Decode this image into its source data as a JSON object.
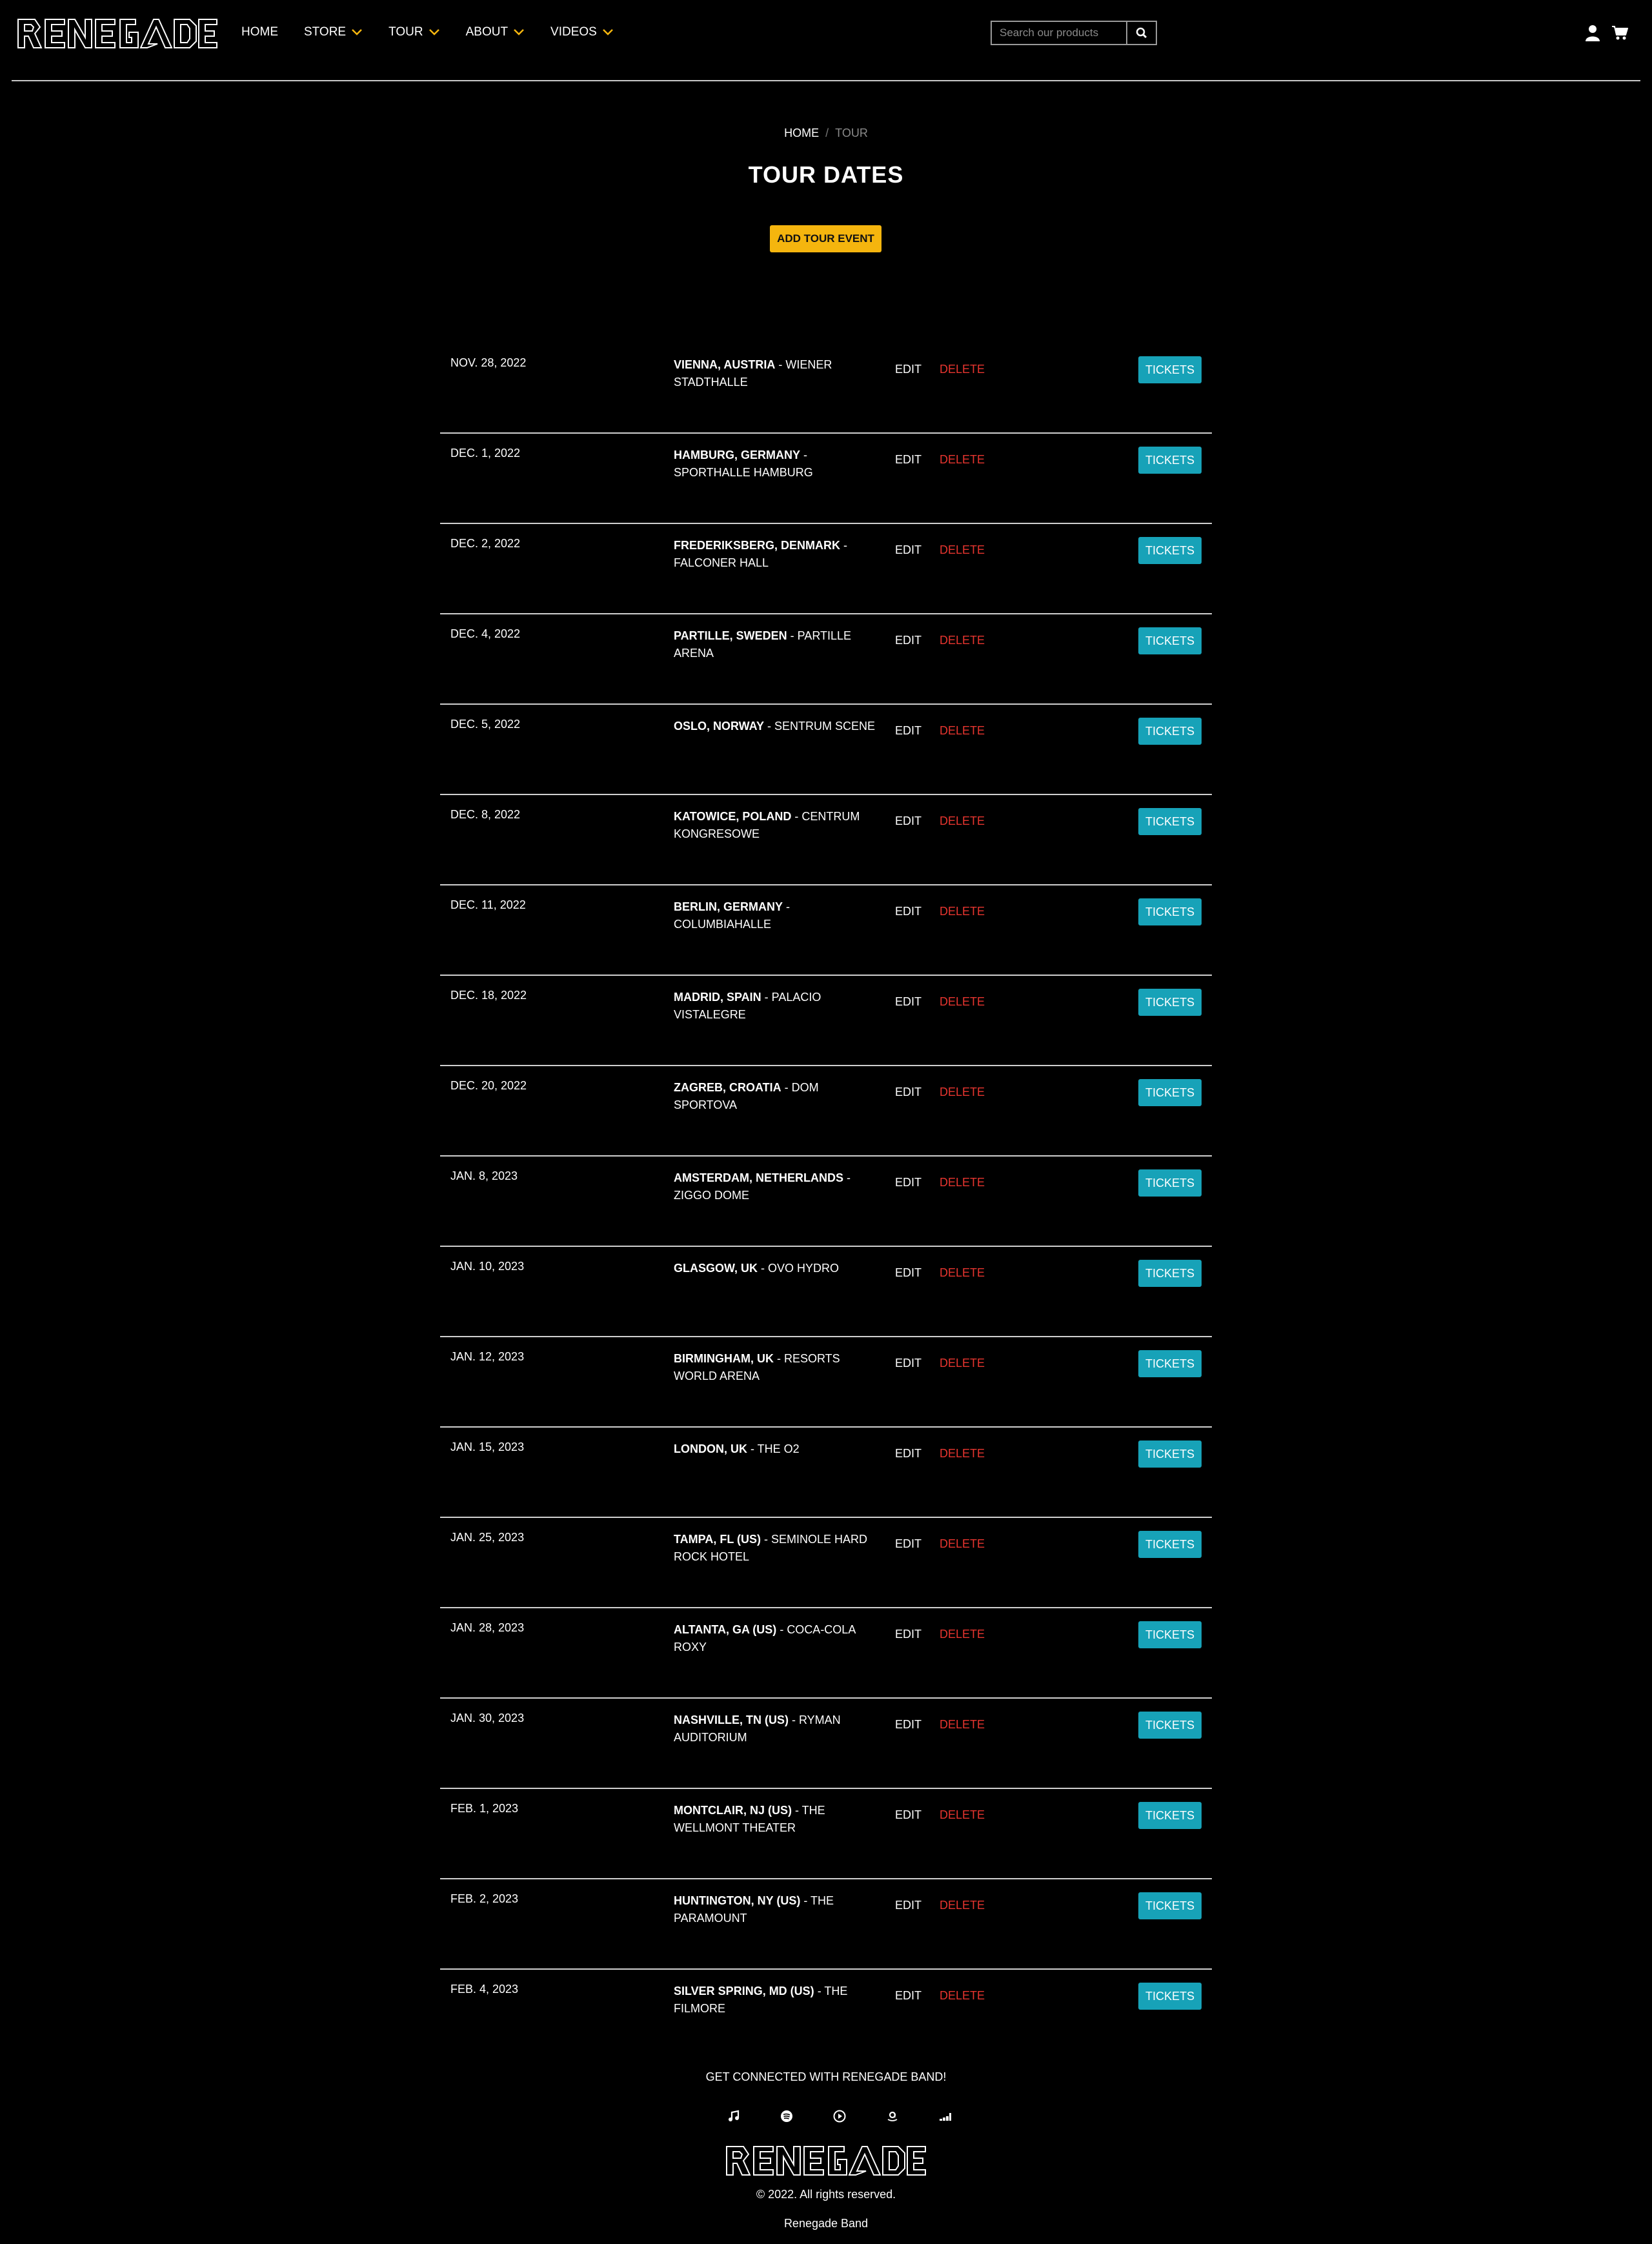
{
  "header": {
    "logo_text": "RENEGADE",
    "nav": [
      {
        "label": "HOME",
        "dropdown": false
      },
      {
        "label": "STORE",
        "dropdown": true
      },
      {
        "label": "TOUR",
        "dropdown": true
      },
      {
        "label": "ABOUT",
        "dropdown": true
      },
      {
        "label": "VIDEOS",
        "dropdown": true
      }
    ],
    "search_placeholder": "Search our products",
    "icons": [
      "search-icon",
      "user-icon",
      "cart-icon",
      "chevron-down-icon"
    ]
  },
  "breadcrumb": {
    "home": "HOME",
    "separator": "/",
    "current": "TOUR"
  },
  "page_title": "TOUR DATES",
  "add_button": "ADD TOUR EVENT",
  "row_labels": {
    "edit": "EDIT",
    "delete": "DELETE",
    "tickets": "TICKETS"
  },
  "tour_dates": [
    {
      "date": "NOV. 28, 2022",
      "city": "VIENNA, AUSTRIA",
      "venue": "WIENER STADTHALLE"
    },
    {
      "date": "DEC. 1, 2022",
      "city": "HAMBURG, GERMANY",
      "venue": "SPORTHALLE HAMBURG"
    },
    {
      "date": "DEC. 2, 2022",
      "city": "FREDERIKSBERG, DENMARK",
      "venue": "FALCONER HALL"
    },
    {
      "date": "DEC. 4, 2022",
      "city": "PARTILLE, SWEDEN",
      "venue": "PARTILLE ARENA"
    },
    {
      "date": "DEC. 5, 2022",
      "city": "OSLO, NORWAY",
      "venue": "SENTRUM SCENE"
    },
    {
      "date": "DEC. 8, 2022",
      "city": "KATOWICE, POLAND",
      "venue": "CENTRUM KONGRESOWE"
    },
    {
      "date": "DEC. 11, 2022",
      "city": "BERLIN, GERMANY",
      "venue": "COLUMBIAHALLE"
    },
    {
      "date": "DEC. 18, 2022",
      "city": "MADRID, SPAIN",
      "venue": "PALACIO VISTALEGRE"
    },
    {
      "date": "DEC. 20, 2022",
      "city": "ZAGREB, CROATIA",
      "venue": "DOM SPORTOVA"
    },
    {
      "date": "JAN. 8, 2023",
      "city": "AMSTERDAM, NETHERLANDS",
      "venue": "ZIGGO DOME"
    },
    {
      "date": "JAN. 10, 2023",
      "city": "GLASGOW, UK",
      "venue": "OVO HYDRO"
    },
    {
      "date": "JAN. 12, 2023",
      "city": "BIRMINGHAM, UK",
      "venue": "RESORTS WORLD ARENA"
    },
    {
      "date": "JAN. 15, 2023",
      "city": "LONDON, UK",
      "venue": "THE O2"
    },
    {
      "date": "JAN. 25, 2023",
      "city": "TAMPA, FL (US)",
      "venue": "SEMINOLE HARD ROCK HOTEL"
    },
    {
      "date": "JAN. 28, 2023",
      "city": "ALTANTA, GA (US)",
      "venue": "COCA-COLA ROXY"
    },
    {
      "date": "JAN. 30, 2023",
      "city": "NASHVILLE, TN (US)",
      "venue": "RYMAN AUDITORIUM"
    },
    {
      "date": "FEB. 1, 2023",
      "city": "MONTCLAIR, NJ (US)",
      "venue": "THE WELLMONT THEATER"
    },
    {
      "date": "FEB. 2, 2023",
      "city": "HUNTINGTON, NY (US)",
      "venue": "THE PARAMOUNT"
    },
    {
      "date": "FEB. 4, 2023",
      "city": "SILVER SPRING, MD (US)",
      "venue": "THE FILMORE"
    }
  ],
  "footer": {
    "heading": "GET CONNECTED WITH RENEGADE BAND!",
    "social_icons": [
      "music-note-icon",
      "spotify-icon",
      "play-circle-icon",
      "amazon-icon",
      "deezer-icon"
    ],
    "copyright": "© 2022. All rights reserved.",
    "band_name": "Renegade Band"
  },
  "colors": {
    "accent": "#f5b50e",
    "tickets": "#17a2b8",
    "delete": "#e8352f",
    "background": "#000000"
  }
}
